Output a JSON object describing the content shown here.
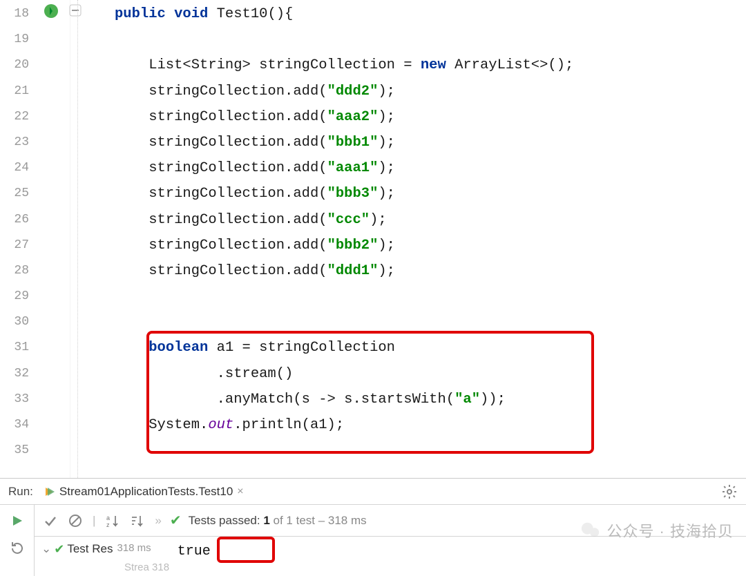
{
  "lines": {
    "start": 18,
    "count": 18
  },
  "code": {
    "l18_pre": "",
    "l18_kw": "public void",
    "l18_post": " Test10(){",
    "l20a": "    List<String> stringCollection = ",
    "l20kw": "new",
    "l20b": " ArrayList<>();",
    "l21a": "    stringCollection.add(",
    "s21": "\"ddd2\"",
    "l21b": ");",
    "l22a": "    stringCollection.add(",
    "s22": "\"aaa2\"",
    "l22b": ");",
    "l23a": "    stringCollection.add(",
    "s23": "\"bbb1\"",
    "l23b": ");",
    "l24a": "    stringCollection.add(",
    "s24": "\"aaa1\"",
    "l24b": ");",
    "l25a": "    stringCollection.add(",
    "s25": "\"bbb3\"",
    "l25b": ");",
    "l26a": "    stringCollection.add(",
    "s26": "\"ccc\"",
    "l26b": ");",
    "l27a": "    stringCollection.add(",
    "s27": "\"bbb2\"",
    "l27b": ");",
    "l28a": "    stringCollection.add(",
    "s28": "\"ddd1\"",
    "l28b": ");",
    "l31kw": "boolean",
    "l31b": " a1 = stringCollection",
    "l32": "            .stream()",
    "l33a": "            .anyMatch(s -> s.startsWith(",
    "s33": "\"a\"",
    "l33b": "));",
    "l34a": "    System.",
    "l34fld": "out",
    "l34b": ".println(a1);"
  },
  "run": {
    "label": "Run:",
    "tab": "Stream01ApplicationTests.Test10",
    "passed_prefix": "Tests passed:",
    "passed_bold": " 1",
    "passed_dim": " of 1 test – 318 ms",
    "tree_name": "Test Res",
    "tree_time": "318 ms",
    "tree_sub": "Strea 318",
    "output": "true"
  },
  "watermark": "公众号 · 技海拾贝"
}
